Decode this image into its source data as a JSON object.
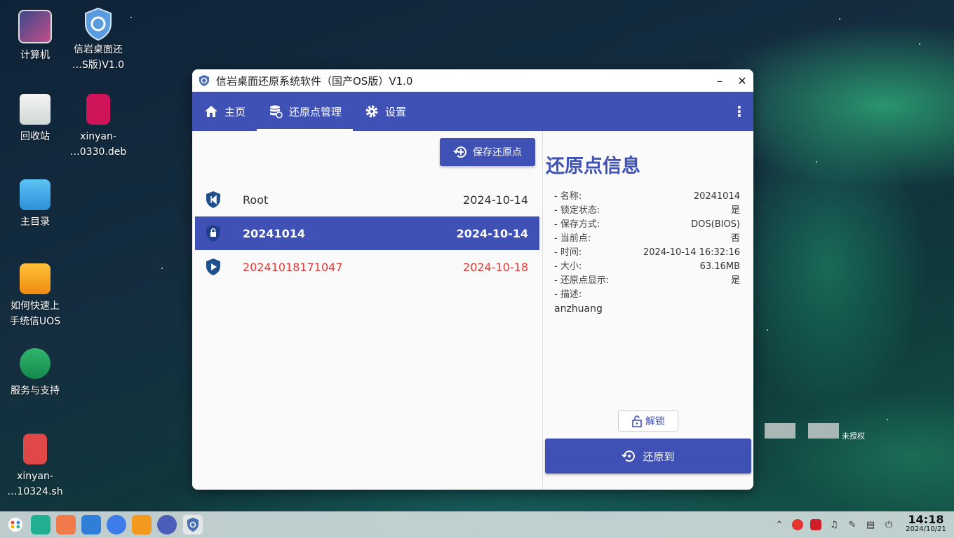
{
  "desktop": {
    "icons": [
      {
        "label": "计算机"
      },
      {
        "label": "信岩桌面还\n…S版)V1.0",
        "line1": "信岩桌面还",
        "line2": "…S版)V1.0"
      },
      {
        "label": "回收站"
      },
      {
        "line1": "xinyan-",
        "line2": "…0330.deb"
      },
      {
        "label": "主目录"
      },
      {
        "line1": "如何快速上",
        "line2": "手统信UOS"
      },
      {
        "label": "服务与支持"
      },
      {
        "line1": "xinyan-",
        "line2": "…10324.sh"
      }
    ],
    "unauthorized_text": "未授权"
  },
  "window": {
    "title": "信岩桌面还原系统软件（国产OS版）V1.0",
    "minimize": "–",
    "close": "✕"
  },
  "nav": {
    "items": [
      {
        "label": "主页",
        "icon": "home-icon"
      },
      {
        "label": "还原点管理",
        "icon": "database-icon"
      },
      {
        "label": "设置",
        "icon": "gear-icon"
      }
    ],
    "active_index": 1,
    "more": "⋮"
  },
  "restore_points": {
    "save_button": "保存还原点",
    "rows": [
      {
        "name": "Root",
        "date": "2024-10-14",
        "icon": "shield-first-icon"
      },
      {
        "name": "20241014",
        "date": "2024-10-14",
        "icon": "shield-lock-icon"
      },
      {
        "name": "20241018171047",
        "date": "2024-10-18",
        "icon": "shield-play-icon"
      }
    ]
  },
  "info": {
    "title": "还原点信息",
    "fields": [
      {
        "key": " - 名称:",
        "value": "20241014"
      },
      {
        "key": " - 锁定状态:",
        "value": "是"
      },
      {
        "key": " - 保存方式:",
        "value": "DOS(BIOS)"
      },
      {
        "key": " - 当前点:",
        "value": "否"
      },
      {
        "key": " - 时间:",
        "value": "2024-10-14 16:32:16"
      },
      {
        "key": " - 大小:",
        "value": "63.16MB"
      },
      {
        "key": " - 还原点显示:",
        "value": "是"
      },
      {
        "key": " - 描述:",
        "value": ""
      }
    ],
    "description": "anzhuang",
    "unlock_button": "解锁",
    "restore_button": "还原到"
  },
  "taskbar": {
    "time": "14:18",
    "date": "2024/10/21"
  },
  "colors": {
    "primary": "#3f51b5",
    "new_point": "#e53935"
  }
}
